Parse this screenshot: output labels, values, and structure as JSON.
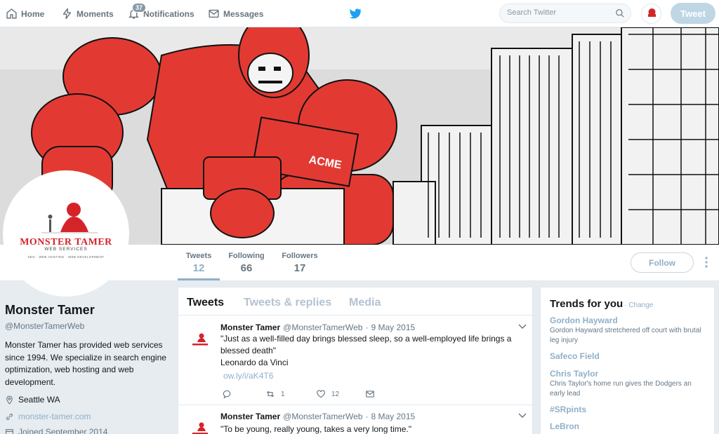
{
  "nav": {
    "home": "Home",
    "moments": "Moments",
    "notifications": "Notifications",
    "notifications_count": "37",
    "messages": "Messages",
    "search_placeholder": "Search Twitter",
    "tweet_button": "Tweet",
    "avatar_logo_name": "MONSTER TAMER"
  },
  "banner": {
    "robot_label": "ACME"
  },
  "profile_nav": {
    "stats": [
      {
        "label": "Tweets",
        "value": "12"
      },
      {
        "label": "Following",
        "value": "66"
      },
      {
        "label": "Followers",
        "value": "17"
      }
    ],
    "follow_button": "Follow"
  },
  "avatar_logo": {
    "name": "MONSTER TAMER",
    "subtitle": "WEB SERVICES",
    "tagline": "SEO · WEB HOSTING · WEB DEVELOPMENT"
  },
  "profile": {
    "name": "Monster Tamer",
    "handle": "@MonsterTamerWeb",
    "bio": "Monster Tamer has provided web services since 1994. We specialize in search engine optimization, web hosting and web development.",
    "location": "Seattle WA",
    "website": "monster-tamer.com",
    "joined": "Joined September 2014"
  },
  "timeline": {
    "tabs": [
      "Tweets",
      "Tweets & replies",
      "Media"
    ],
    "tweets": [
      {
        "name": "Monster Tamer",
        "handle": "@MonsterTamerWeb",
        "date": "9 May 2015",
        "text": "\"Just as a well-filled day brings blessed sleep, so a well-employed life brings a blessed death\"",
        "text2": "Leonardo da Vinci",
        "link": "ow.ly/i/aK4T6",
        "retweets": "1",
        "likes": "12"
      },
      {
        "name": "Monster Tamer",
        "handle": "@MonsterTamerWeb",
        "date": "8 May 2015",
        "text": "\"To be young, really young, takes a very long time.\""
      }
    ]
  },
  "trends": {
    "title": "Trends for you",
    "change": "· Change",
    "items": [
      {
        "name": "Gordon Hayward",
        "desc": "Gordon Hayward stretchered off court with brutal leg injury"
      },
      {
        "name": "Safeco Field",
        "desc": ""
      },
      {
        "name": "Chris Taylor",
        "desc": "Chris Taylor's home run gives the Dodgers an early lead"
      },
      {
        "name": "#SRpints",
        "desc": ""
      },
      {
        "name": "LeBron",
        "desc": ""
      }
    ]
  },
  "colors": {
    "accent": "#8fb0c9",
    "brand_red": "#d4242a",
    "twitter_blue": "#1da1f2"
  }
}
